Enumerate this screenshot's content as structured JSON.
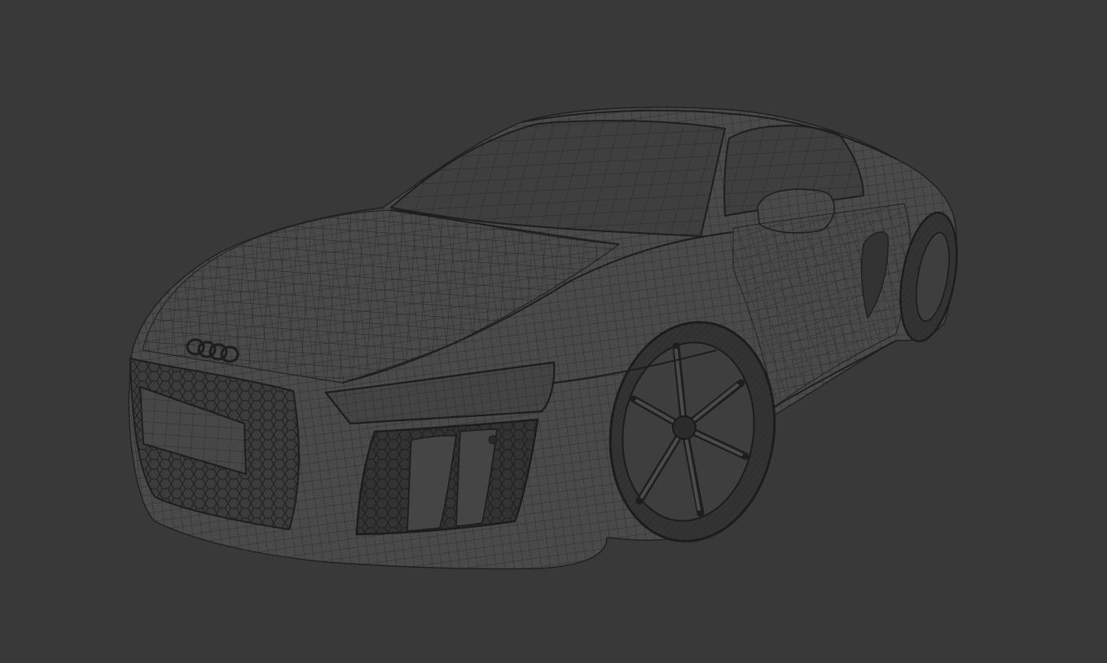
{
  "viewport": {
    "background": "#393939",
    "model_fill": "#4a4a4a",
    "model_fill_dark": "#3b3b3b",
    "wire_color": "#262626",
    "view_mode": "wireframe",
    "subject": "car-wireframe-model"
  }
}
